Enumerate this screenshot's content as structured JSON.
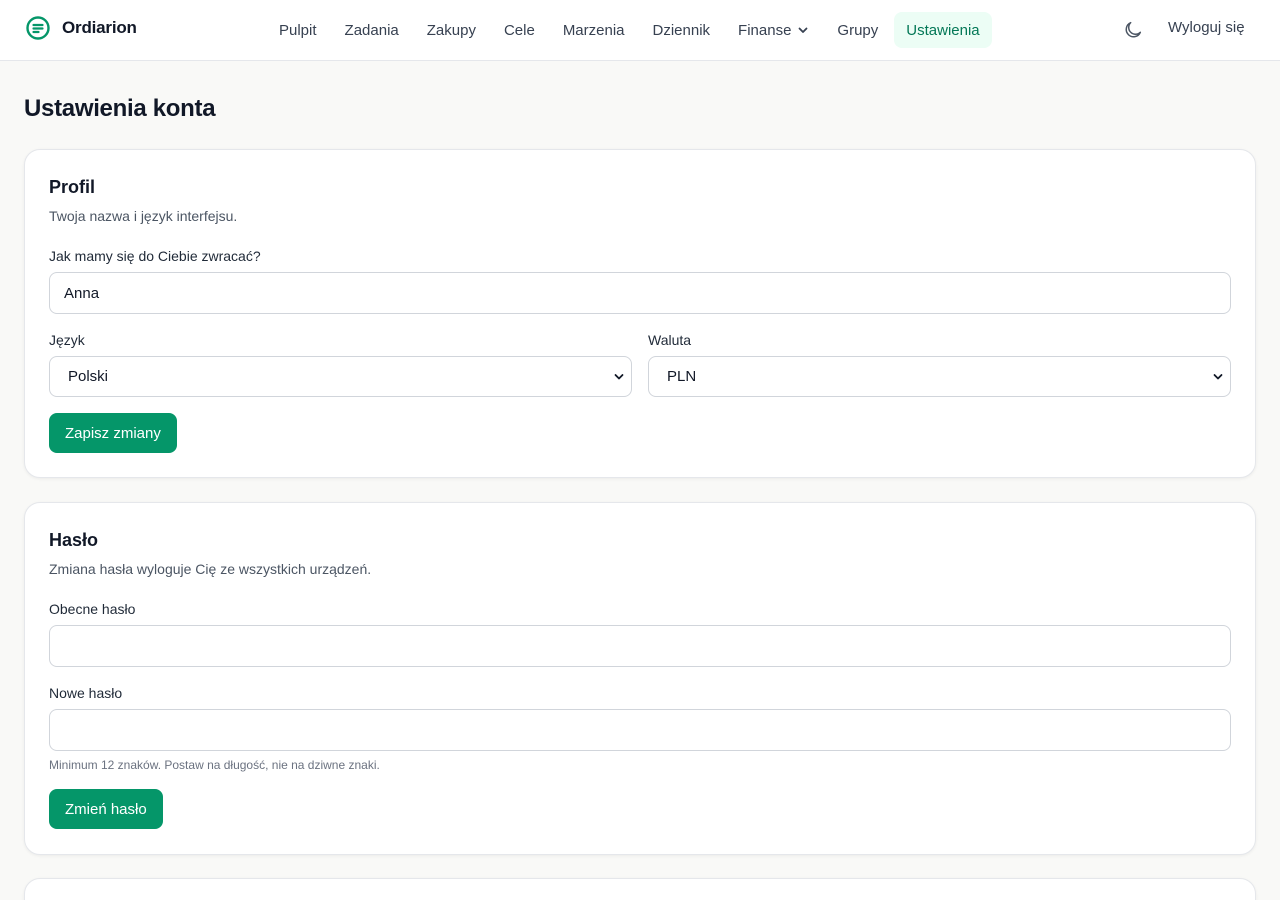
{
  "app": {
    "name": "Ordiarion",
    "accent": "#059669",
    "logo_icon": "app-logo-icon"
  },
  "nav": {
    "items": [
      {
        "label": "Pulpit"
      },
      {
        "label": "Zadania"
      },
      {
        "label": "Zakupy"
      },
      {
        "label": "Cele"
      },
      {
        "label": "Marzenia"
      },
      {
        "label": "Dziennik"
      },
      {
        "label": "Finanse",
        "has_dropdown": true
      },
      {
        "label": "Grupy"
      },
      {
        "label": "Ustawienia",
        "active": true
      }
    ],
    "theme_toggle_icon": "moon-icon",
    "logout_label": "Wyloguj się"
  },
  "page": {
    "title": "Ustawienia konta"
  },
  "profile": {
    "title": "Profil",
    "description": "Twoja nazwa i język interfejsu.",
    "name_label": "Jak mamy się do Ciebie zwracać?",
    "name_value": "Anna",
    "language_label": "Język",
    "language_value": "Polski",
    "currency_label": "Waluta",
    "currency_value": "PLN",
    "save_label": "Zapisz zmiany"
  },
  "password": {
    "title": "Hasło",
    "description": "Zmiana hasła wyloguje Cię ze wszystkich urządzeń.",
    "current_label": "Obecne hasło",
    "current_value": "",
    "new_label": "Nowe hasło",
    "new_value": "",
    "hint": "Minimum 12 znaków. Postaw na długość, nie na dziwne znaki.",
    "submit_label": "Zmień hasło"
  }
}
